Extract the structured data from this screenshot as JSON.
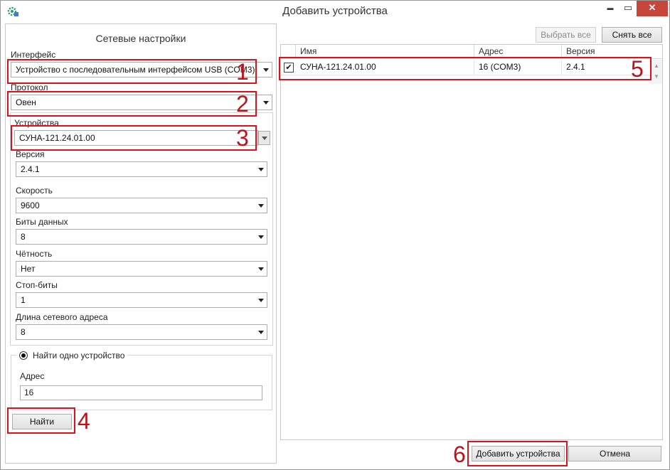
{
  "window": {
    "title": "Добавить устройства",
    "minimize": "▬",
    "maximize": "▭",
    "close": "✕",
    "app_icon": "app-gear-icon"
  },
  "left": {
    "heading": "Сетевые настройки",
    "interface_label": "Интерфейс",
    "interface_value": "Устройство с последовательным интерфейсом USB (COM3)",
    "protocol_label": "Протокол",
    "protocol_value": "Овен",
    "devices_label": "Устройства",
    "devices_value": "СУНА-121.24.01.00",
    "version_label": "Версия",
    "version_value": "2.4.1",
    "speed_label": "Скорость",
    "speed_value": "9600",
    "databits_label": "Биты данных",
    "databits_value": "8",
    "parity_label": "Чётность",
    "parity_value": "Нет",
    "stopbits_label": "Стоп-биты",
    "stopbits_value": "1",
    "addrlen_label": "Длина сетевого адреса",
    "addrlen_value": "8",
    "find_one_label": "Найти одно устройство",
    "address_label": "Адрес",
    "address_value": "16",
    "find_button": "Найти"
  },
  "right": {
    "select_all": "Выбрать все",
    "clear_all": "Снять все",
    "columns": [
      "Имя",
      "Адрес",
      "Версия"
    ],
    "rows": [
      {
        "checked": true,
        "name": "СУНА-121.24.01.00",
        "address": "16 (COM3)",
        "version": "2.4.1"
      }
    ],
    "checkmark": "✔"
  },
  "footer": {
    "add_button": "Добавить устройства",
    "cancel_button": "Отмена"
  },
  "callouts": [
    "1",
    "2",
    "3",
    "4",
    "5",
    "6"
  ],
  "accent_color": "#e0101a"
}
